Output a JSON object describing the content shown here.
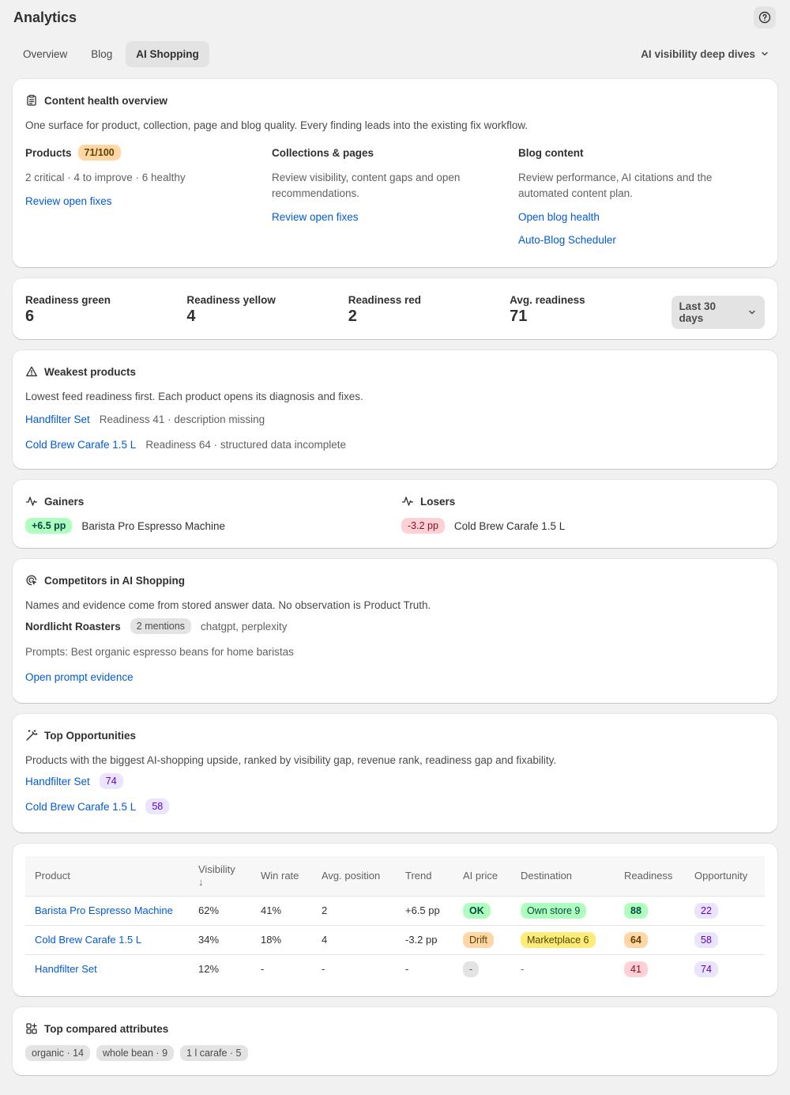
{
  "header": {
    "title": "Analytics",
    "help_icon": "question-circle-icon"
  },
  "tabs": [
    {
      "label": "Overview",
      "active": false
    },
    {
      "label": "Blog",
      "active": false
    },
    {
      "label": "AI Shopping",
      "active": true
    }
  ],
  "deep_dives_label": "AI visibility deep dives",
  "content_health": {
    "title": "Content health overview",
    "description": "One surface for product, collection, page and blog quality. Every finding leads into the existing fix workflow.",
    "products": {
      "title": "Products",
      "score": "71/100",
      "summary": "2 critical · 4 to improve · 6 healthy",
      "link": "Review open fixes"
    },
    "collections": {
      "title": "Collections & pages",
      "summary": "Review visibility, content gaps and open recommendations.",
      "link": "Review open fixes"
    },
    "blog": {
      "title": "Blog content",
      "summary": "Review performance, AI citations and the automated content plan.",
      "link1": "Open blog health",
      "link2": "Auto-Blog Scheduler"
    }
  },
  "readiness": {
    "green_label": "Readiness green",
    "green_value": "6",
    "yellow_label": "Readiness yellow",
    "yellow_value": "4",
    "red_label": "Readiness red",
    "red_value": "2",
    "avg_label": "Avg. readiness",
    "avg_value": "71",
    "range": "Last 30 days"
  },
  "weakest": {
    "title": "Weakest products",
    "description": "Lowest feed readiness first. Each product opens its diagnosis and fixes.",
    "items": [
      {
        "name": "Handfilter Set",
        "detail": "Readiness 41 · description missing"
      },
      {
        "name": "Cold Brew Carafe 1.5 L",
        "detail": "Readiness 64 · structured data incomplete"
      }
    ]
  },
  "movers": {
    "gainers_title": "Gainers",
    "gainer_delta": "+6.5 pp",
    "gainer_name": "Barista Pro Espresso Machine",
    "losers_title": "Losers",
    "loser_delta": "-3.2 pp",
    "loser_name": "Cold Brew Carafe 1.5 L"
  },
  "competitors": {
    "title": "Competitors in AI Shopping",
    "description": "Names and evidence come from stored answer data. No observation is Product Truth.",
    "name": "Nordlicht Roasters",
    "mentions": "2 mentions",
    "sources": "chatgpt, perplexity",
    "prompts": "Prompts: Best organic espresso beans for home baristas",
    "link": "Open prompt evidence"
  },
  "opportunities": {
    "title": "Top Opportunities",
    "description": "Products with the biggest AI-shopping upside, ranked by visibility gap, revenue rank, readiness gap and fixability.",
    "items": [
      {
        "name": "Handfilter Set",
        "score": "74"
      },
      {
        "name": "Cold Brew Carafe 1.5 L",
        "score": "58"
      }
    ]
  },
  "table": {
    "headers": {
      "product": "Product",
      "visibility": "Visibility",
      "visibility_sort": "↓",
      "win_rate": "Win rate",
      "avg_position": "Avg. position",
      "trend": "Trend",
      "ai_price": "AI price",
      "destination": "Destination",
      "readiness": "Readiness",
      "opportunity": "Opportunity"
    },
    "rows": [
      {
        "product": "Barista Pro Espresso Machine",
        "visibility": "62%",
        "win_rate": "41%",
        "avg_position": "2",
        "trend": "+6.5 pp",
        "ai_price": "OK",
        "destination": "Own store 9",
        "readiness": "88",
        "opportunity": "22"
      },
      {
        "product": "Cold Brew Carafe 1.5 L",
        "visibility": "34%",
        "win_rate": "18%",
        "avg_position": "4",
        "trend": "-3.2 pp",
        "ai_price": "Drift",
        "destination": "Marketplace 6",
        "readiness": "64",
        "opportunity": "58"
      },
      {
        "product": "Handfilter Set",
        "visibility": "12%",
        "win_rate": "-",
        "avg_position": "-",
        "trend": "-",
        "ai_price": "-",
        "destination": "-",
        "readiness": "41",
        "opportunity": "74"
      }
    ]
  },
  "attributes": {
    "title": "Top compared attributes",
    "chips": [
      "organic · 14",
      "whole bean · 9",
      "1 l carafe · 5"
    ]
  }
}
